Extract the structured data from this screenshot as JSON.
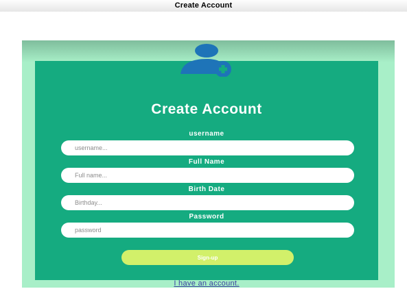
{
  "window": {
    "title": "Create Account"
  },
  "form": {
    "heading": "Create Account",
    "fields": [
      {
        "label": "username",
        "placeholder": "username...",
        "value": ""
      },
      {
        "label": "Full Name",
        "placeholder": "Full name...",
        "value": ""
      },
      {
        "label": "Birth Date",
        "placeholder": "Birthday...",
        "value": ""
      },
      {
        "label": "Password",
        "placeholder": "password",
        "value": ""
      }
    ],
    "signup_label": "Sign-up",
    "login_link": "I have an account."
  },
  "icons": {
    "avatar": "add-user-icon"
  },
  "colors": {
    "outer_bg": "#a8efc8",
    "card_bg": "#15ab80",
    "button_bg": "#d2f06a",
    "icon": "#1e74b8",
    "link": "#3a3fa0"
  }
}
